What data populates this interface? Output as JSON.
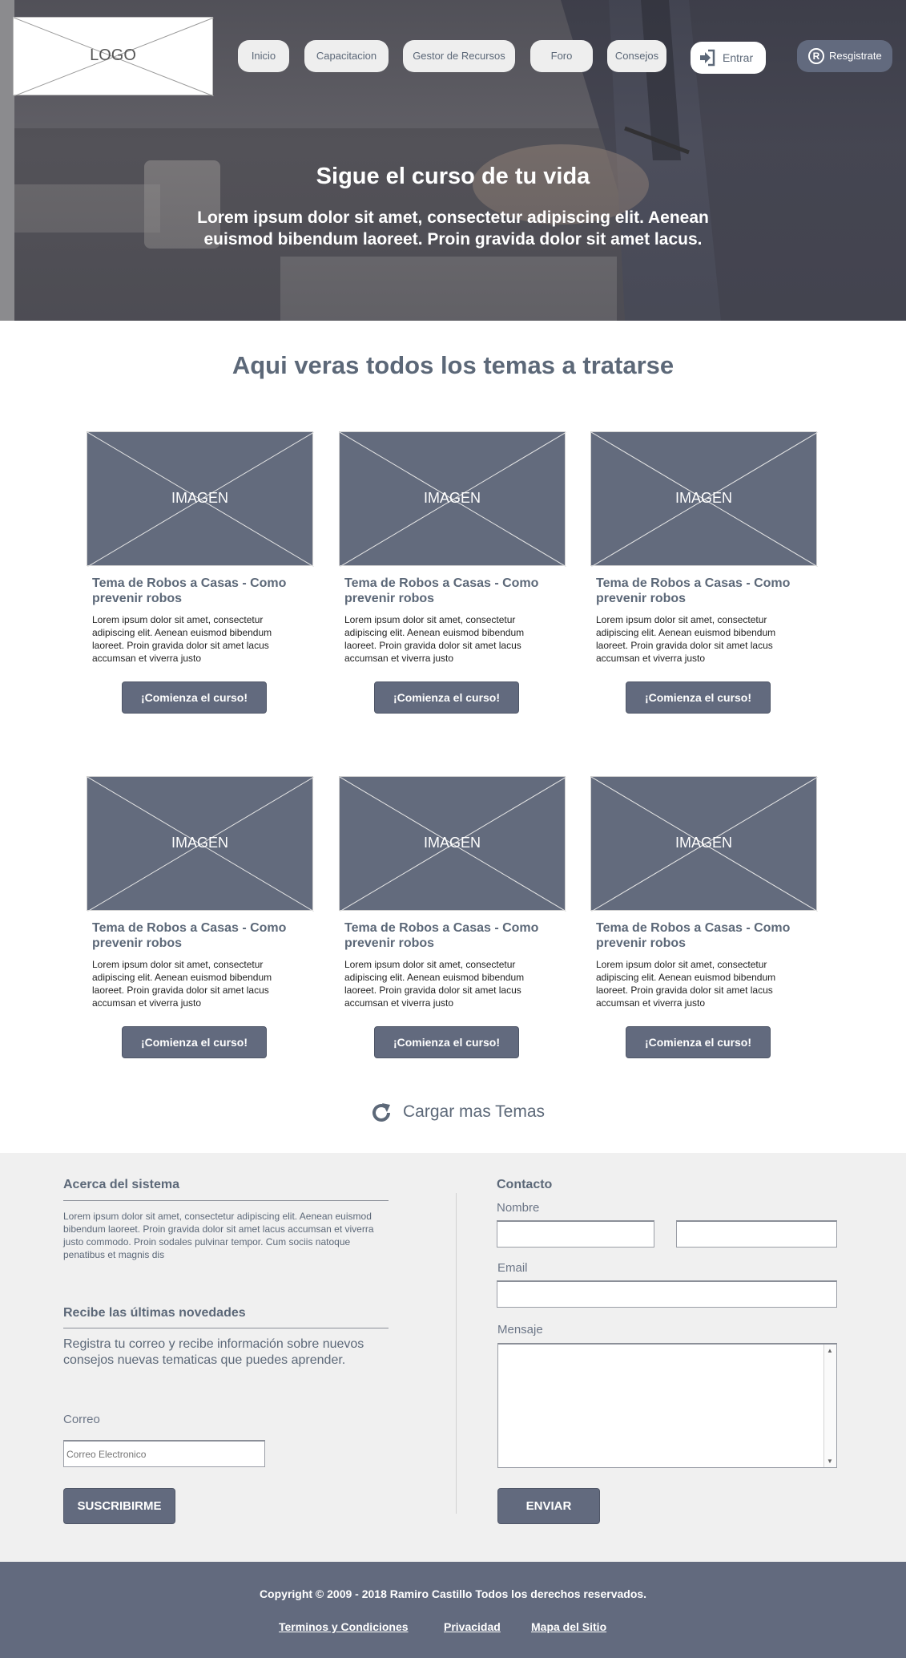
{
  "header": {
    "logo_text": "LOGO",
    "nav": [
      "Inicio",
      "Capacitacion",
      "Gestor de Recursos",
      "Foro",
      "Consejos"
    ],
    "login_label": "Entrar",
    "register_label": "Resgistrate",
    "register_icon_glyph": "R"
  },
  "hero": {
    "title": "Sigue el curso de tu vida",
    "subtitle": "Lorem ipsum dolor sit amet, consectetur adipiscing elit. Aenean euismod bibendum laoreet. Proin gravida dolor sit amet lacus."
  },
  "topics": {
    "heading": "Aqui veras todos los temas a tratarse",
    "cards": [
      {
        "image_label": "IMAGEN",
        "title": "Tema de Robos a Casas - Como prevenir robos",
        "text": "Lorem ipsum dolor sit amet, consectetur adipiscing elit. Aenean euismod bibendum laoreet. Proin gravida dolor sit amet lacus accumsan et viverra justo",
        "button": "¡Comienza el curso!"
      },
      {
        "image_label": "IMAGEN",
        "title": "Tema de Robos a Casas - Como prevenir robos",
        "text": "Lorem ipsum dolor sit amet, consectetur adipiscing elit. Aenean euismod bibendum laoreet. Proin gravida dolor sit amet lacus accumsan et viverra justo",
        "button": "¡Comienza el curso!"
      },
      {
        "image_label": "IMAGEN",
        "title": "Tema de Robos a Casas - Como prevenir robos",
        "text": "Lorem ipsum dolor sit amet, consectetur adipiscing elit. Aenean euismod bibendum laoreet. Proin gravida dolor sit amet lacus accumsan et viverra justo",
        "button": "¡Comienza el curso!"
      },
      {
        "image_label": "IMAGEN",
        "title": "Tema de Robos a Casas - Como prevenir robos",
        "text": "Lorem ipsum dolor sit amet, consectetur adipiscing elit. Aenean euismod bibendum laoreet. Proin gravida dolor sit amet lacus accumsan et viverra justo",
        "button": "¡Comienza el curso!"
      },
      {
        "image_label": "IMAGEN",
        "title": "Tema de Robos a Casas - Como prevenir robos",
        "text": "Lorem ipsum dolor sit amet, consectetur adipiscing elit. Aenean euismod bibendum laoreet. Proin gravida dolor sit amet lacus accumsan et viverra justo",
        "button": "¡Comienza el curso!"
      },
      {
        "image_label": "IMAGEN",
        "title": "Tema de Robos a Casas - Como prevenir robos",
        "text": "Lorem ipsum dolor sit amet, consectetur adipiscing elit. Aenean euismod bibendum laoreet. Proin gravida dolor sit amet lacus accumsan et viverra justo",
        "button": "¡Comienza el curso!"
      }
    ],
    "load_more": "Cargar mas Temas"
  },
  "about": {
    "title": "Acerca del sistema",
    "text": "Lorem ipsum dolor sit amet, consectetur adipiscing elit. Aenean euismod bibendum laoreet. Proin gravida dolor sit amet lacus accumsan et viverra justo commodo. Proin sodales pulvinar tempor. Cum sociis natoque penatibus et magnis dis"
  },
  "newsletter": {
    "title": "Recibe las últimas novedades",
    "text": "Registra tu correo y recibe información sobre nuevos consejos nuevas tematicas que puedes aprender.",
    "email_label": "Correo",
    "email_placeholder": "Correo Electronico",
    "button": "SUSCRIBIRME"
  },
  "contact": {
    "title": "Contacto",
    "name_label": "Nombre",
    "email_label": "Email",
    "message_label": "Mensaje",
    "button": "ENVIAR"
  },
  "footer": {
    "copyright": "Copyright © 2009 - 2018 Ramiro Castillo Todos los derechos reservados.",
    "links": [
      "Terminos y  Condiciones",
      "Privacidad",
      "Mapa del Sitio"
    ]
  },
  "colors": {
    "accent": "#626a7e",
    "heading": "#5c6878",
    "panel": "#f0f0f0"
  }
}
